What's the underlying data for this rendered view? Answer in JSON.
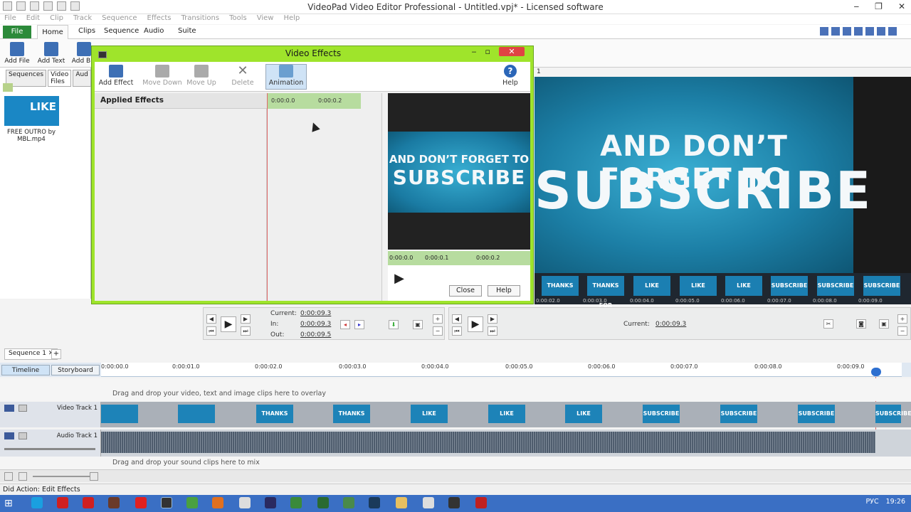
{
  "window": {
    "title": "VideoPad Video Editor Professional - Untitled.vpj* - Licensed software"
  },
  "menu": [
    "File",
    "Edit",
    "Clip",
    "Track",
    "Sequence",
    "Effects",
    "Transitions",
    "Tools",
    "View",
    "Help"
  ],
  "ribbon_tabs": {
    "file": "File",
    "home": "Home",
    "clips": "Clips",
    "sequence": "Sequence",
    "audio": "Audio",
    "suite": "Suite"
  },
  "ribbon_buttons": {
    "add_file": "Add File",
    "add_text": "Add Text",
    "add_blank": "Add Bla"
  },
  "left_pane": {
    "tab_sequences": "Sequences",
    "tab_video_files": "Video Files",
    "tab_audio": "Aud",
    "clip_caption": "FREE OUTRO by MBL.mp4",
    "clip_thumb_text": "LIKE"
  },
  "preview": {
    "line1": "AND DON’T FORGET TO",
    "line2": "SUBSCRIBE",
    "seq_number": "1"
  },
  "filmstrip": {
    "frames": [
      "THANKS",
      "THANKS FOR",
      "LIKE",
      "LIKE",
      "LIKE",
      "SUBSCRIBE",
      "SUBSCRIBE",
      "SUBSCRIBE"
    ],
    "timecodes": [
      "0:00:02.0",
      "0:00:03.0",
      "0:00:04.0",
      "0:00:05.0",
      "0:00:06.0",
      "0:00:07.0",
      "0:00:08.0",
      "0:00:09.0"
    ]
  },
  "clip_transport": {
    "current_label": "Current:",
    "current_value": "0:00:09.3",
    "in_label": "In:",
    "in_value": "0:00:09.3",
    "out_label": "Out:",
    "out_value": "0:00:09.5"
  },
  "seq_transport": {
    "current_label": "Current:",
    "current_value": "0:00:09.3"
  },
  "sequence_tab": {
    "label": "Sequence 1"
  },
  "timeline": {
    "view_timeline": "Timeline",
    "view_storyboard": "Storyboard",
    "ticks": [
      "0:00:00.0",
      "0:00:01.0",
      "0:00:02.0",
      "0:00:03.0",
      "0:00:04.0",
      "0:00:05.0",
      "0:00:06.0",
      "0:00:07.0",
      "0:00:08.0",
      "0:00:09.0"
    ],
    "overlay_hint": "Drag and drop your video, text and image clips here to overlay",
    "video_track": "Video Track 1",
    "audio_track": "Audio Track 1",
    "sound_hint": "Drag and drop your sound clips here to mix",
    "video_clips": [
      "",
      "",
      "THANKS FOR",
      "THANKS FOR",
      "LIKE",
      "LIKE",
      "LIKE",
      "SUBSCRIBE",
      "SUBSCRIBE",
      "SUBSCRIBE",
      "SUBSCRIBE"
    ]
  },
  "status": {
    "text": "Did Action: Edit Effects"
  },
  "taskbar": {
    "lang": "РУС",
    "time": "19:26"
  },
  "dialog": {
    "title": "Video Effects",
    "toolbar": {
      "add_effect": "Add Effect",
      "move_down": "Move Down",
      "move_up": "Move Up",
      "delete": "Delete",
      "animation": "Animation",
      "help": "Help"
    },
    "applied_header": "Applied Effects",
    "ruler_ticks": [
      "0:00:0.0",
      "0:00:0.2"
    ],
    "preview_ruler": [
      "0:00:0.0",
      "0:00:0.1",
      "0:00:0.2"
    ],
    "preview_line1": "AND DON’T FORGET TO",
    "preview_line2": "SUBSCRIBE",
    "close_button": "Close",
    "help_button": "Help"
  }
}
